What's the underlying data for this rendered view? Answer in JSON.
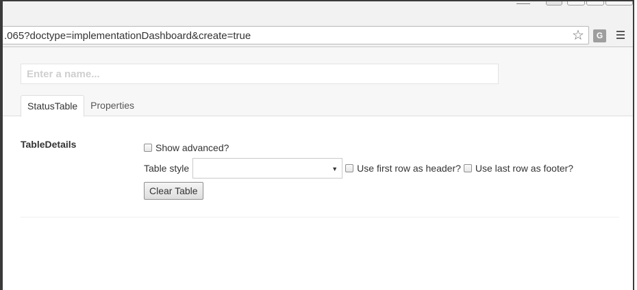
{
  "browser": {
    "url": ".065?doctype=implementationDashboard&create=true",
    "icons": [
      "star-icon",
      "g-extension-icon",
      "menu-icon"
    ],
    "extension_letter": "G"
  },
  "editor": {
    "name_placeholder": "Enter a name...",
    "name_value": "",
    "tabs": [
      {
        "label": "StatusTable",
        "active": true
      },
      {
        "label": "Properties",
        "active": false
      }
    ]
  },
  "table_details": {
    "section_label": "TableDetails",
    "show_advanced_label": "Show advanced?",
    "show_advanced_checked": false,
    "table_style_label": "Table style",
    "table_style_value": "",
    "first_row_header_label": "Use first row as header?",
    "first_row_header_checked": false,
    "last_row_footer_label": "Use last row as footer?",
    "last_row_footer_checked": false,
    "clear_button_label": "Clear Table"
  }
}
